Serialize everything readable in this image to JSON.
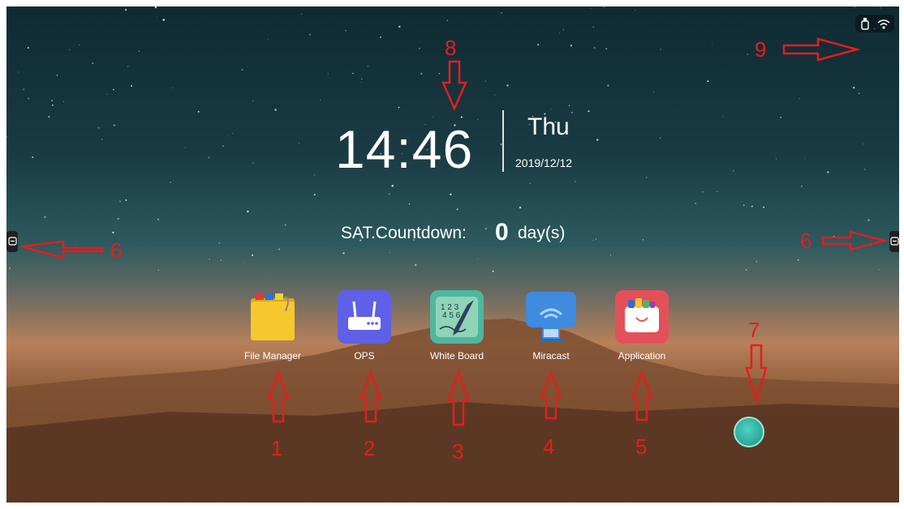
{
  "clock": {
    "time": "14:46",
    "day": "Thu",
    "date": "2019/12/12"
  },
  "countdown": {
    "label": "SAT.Countdown:",
    "value": "0",
    "unit": "day(s)"
  },
  "apps": [
    {
      "label": "File Manager",
      "icon": "folder-icon"
    },
    {
      "label": "OPS",
      "icon": "router-icon"
    },
    {
      "label": "White Board",
      "icon": "whiteboard-icon"
    },
    {
      "label": "Miracast",
      "icon": "screen-cast-icon"
    },
    {
      "label": "Application",
      "icon": "app-store-icon"
    }
  ],
  "status_icons": [
    "usb-icon",
    "wifi-icon"
  ],
  "annotations": [
    "1",
    "2",
    "3",
    "4",
    "5",
    "6",
    "6",
    "7",
    "8",
    "9"
  ],
  "colors": {
    "annotation": "#e41e1e",
    "fab": "#2aa797"
  }
}
